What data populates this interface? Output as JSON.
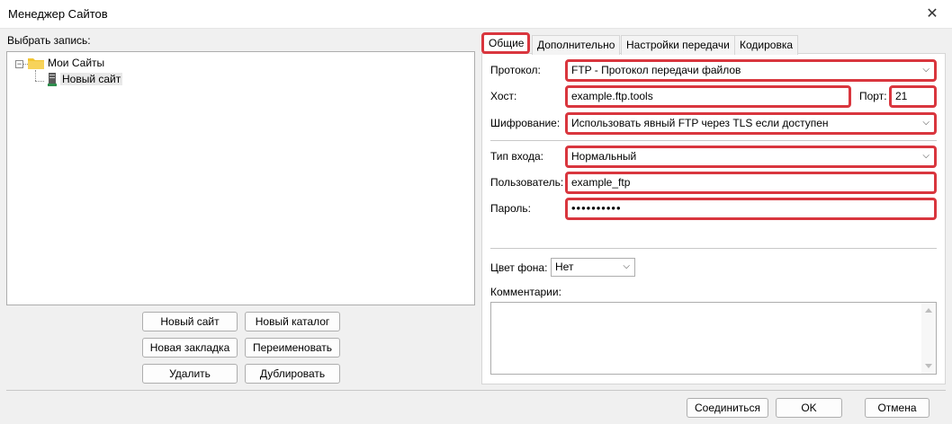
{
  "window": {
    "title": "Менеджер Сайтов",
    "close_symbol": "✕"
  },
  "left": {
    "select_label": "Выбрать запись:",
    "tree": {
      "expander": "−",
      "root_label": "Мои Сайты",
      "child_label": "Новый сайт"
    },
    "buttons": {
      "new_site": "Новый сайт",
      "new_folder": "Новый каталог",
      "new_bookmark": "Новая закладка",
      "rename": "Переименовать",
      "delete": "Удалить",
      "duplicate": "Дублировать"
    }
  },
  "tabs": [
    "Общие",
    "Дополнительно",
    "Настройки передачи",
    "Кодировка"
  ],
  "general": {
    "protocol_label": "Протокол:",
    "protocol_value": "FTP - Протокол передачи файлов",
    "host_label": "Хост:",
    "host_value": "example.ftp.tools",
    "port_label": "Порт:",
    "port_value": "21",
    "encryption_label": "Шифрование:",
    "encryption_value": "Использовать явный FTP через TLS если доступен",
    "logon_label": "Тип входа:",
    "logon_value": "Нормальный",
    "user_label": "Пользователь:",
    "user_value": "example_ftp",
    "password_label": "Пароль:",
    "password_value": "••••••••••",
    "bg_color_label": "Цвет фона:",
    "bg_color_value": "Нет",
    "comments_label": "Комментарии:"
  },
  "footer": {
    "connect": "Соединиться",
    "ok": "OK",
    "cancel": "Отмена"
  },
  "colors": {
    "highlight": "#d9363e",
    "folder": "#f2c531"
  }
}
